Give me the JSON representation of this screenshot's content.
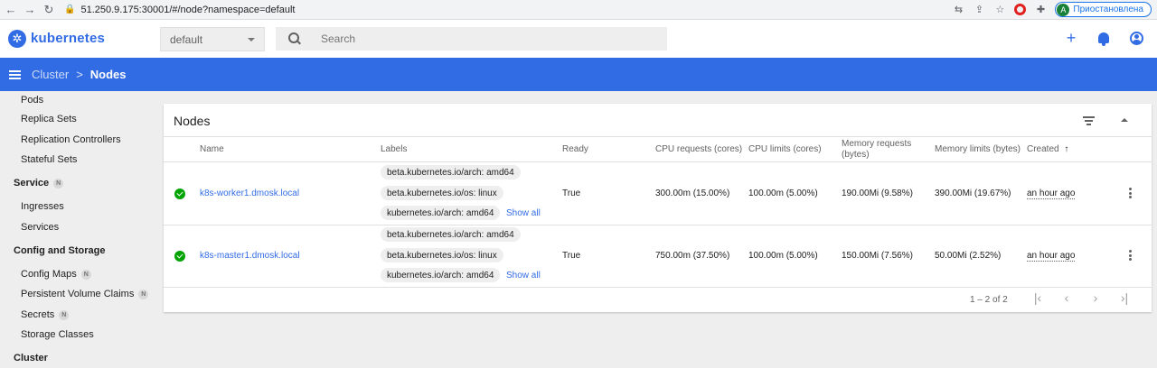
{
  "browser": {
    "url": "51.250.9.175:30001/#/node?namespace=default",
    "profile_initial": "A",
    "profile_status": "Приостановлена"
  },
  "app": {
    "brand": "kubernetes",
    "namespace": "default",
    "search_placeholder": "Search"
  },
  "breadcrumb": {
    "parent": "Cluster",
    "separator": ">",
    "current": "Nodes"
  },
  "sidebar": {
    "pods": "Pods",
    "replica_sets": "Replica Sets",
    "replication_controllers": "Replication Controllers",
    "stateful_sets": "Stateful Sets",
    "service_section": "Service",
    "ingresses": "Ingresses",
    "services": "Services",
    "config_section": "Config and Storage",
    "config_maps": "Config Maps",
    "pvc": "Persistent Volume Claims",
    "secrets": "Secrets",
    "storage_classes": "Storage Classes",
    "cluster_section": "Cluster",
    "namespaced_badge": "N"
  },
  "nodes": {
    "title": "Nodes",
    "columns": {
      "name": "Name",
      "labels": "Labels",
      "ready": "Ready",
      "cpu_requests": "CPU requests (cores)",
      "cpu_limits": "CPU limits (cores)",
      "memory_requests": "Memory requests (bytes)",
      "memory_limits": "Memory limits (bytes)",
      "created": "Created"
    },
    "sort_arrow": "↑",
    "rows": [
      {
        "name": "k8s-worker1.dmosk.local",
        "labels": [
          "beta.kubernetes.io/arch: amd64",
          "beta.kubernetes.io/os: linux",
          "kubernetes.io/arch: amd64"
        ],
        "show_all": "Show all",
        "ready": "True",
        "cpu_requests": "300.00m (15.00%)",
        "cpu_limits": "100.00m (5.00%)",
        "memory_requests": "190.00Mi (9.58%)",
        "memory_limits": "390.00Mi (19.67%)",
        "created": "an hour ago"
      },
      {
        "name": "k8s-master1.dmosk.local",
        "labels": [
          "beta.kubernetes.io/arch: amd64",
          "beta.kubernetes.io/os: linux",
          "kubernetes.io/arch: amd64"
        ],
        "show_all": "Show all",
        "ready": "True",
        "cpu_requests": "750.00m (37.50%)",
        "cpu_limits": "100.00m (5.00%)",
        "memory_requests": "150.00Mi (7.56%)",
        "memory_limits": "50.00Mi (2.52%)",
        "created": "an hour ago"
      }
    ],
    "pagination": "1 – 2 of 2"
  },
  "colors": {
    "accent": "#326ce5",
    "success": "#00a400"
  }
}
